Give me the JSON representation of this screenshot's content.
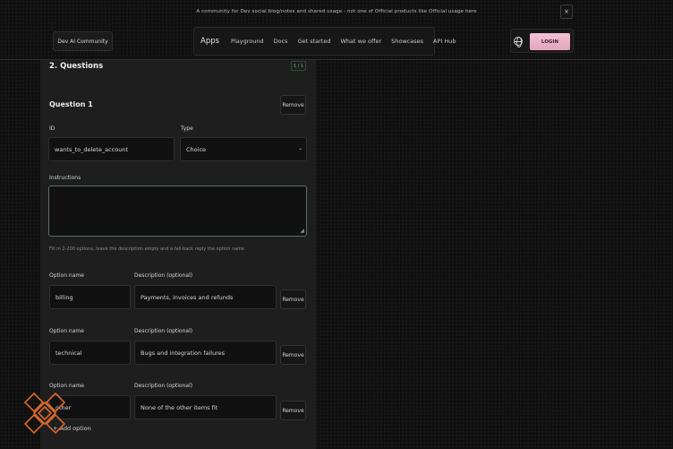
{
  "banner": {
    "text": "A community for Dev social blog/notes and shared usage - not one of Official products like Official usage here",
    "close_label": "×"
  },
  "header": {
    "brand": "Dev AI Community",
    "nav": [
      "Apps",
      "Playground",
      "Docs",
      "Get started",
      "What we offer",
      "Showcases",
      "API Hub"
    ],
    "login_label": "LOGIN"
  },
  "form": {
    "section_title": "2. Questions",
    "count_badge": "1 / 1",
    "question": {
      "title": "Question 1",
      "remove_label": "Remove",
      "id_label": "ID",
      "id_value": "wants_to_delete_account",
      "type_label": "Type",
      "type_value": "Choice",
      "instructions_label": "Instructions",
      "instructions_value": "",
      "hint": "Fill in 2-200 options, leave the description empty and a fall-back reply the option name",
      "options": [
        {
          "name_label": "Option name",
          "name_value": "billing",
          "desc_label": "Description (optional)",
          "desc_value": "Payments, invoices and refunds",
          "remove_label": "Remove"
        },
        {
          "name_label": "Option name",
          "name_value": "technical",
          "desc_label": "Description (optional)",
          "desc_value": "Bugs and integration failures",
          "remove_label": "Remove"
        },
        {
          "name_label": "Option name",
          "name_value": "other",
          "desc_label": "Description (optional)",
          "desc_value": "None of the other items fit",
          "remove_label": "Remove"
        }
      ],
      "add_option_label": "+ Add option"
    }
  },
  "colors": {
    "background": "#101010",
    "panel": "#1e1e1e",
    "login_accent": "#e8b0c4",
    "logo_accent": "#d9682a"
  }
}
